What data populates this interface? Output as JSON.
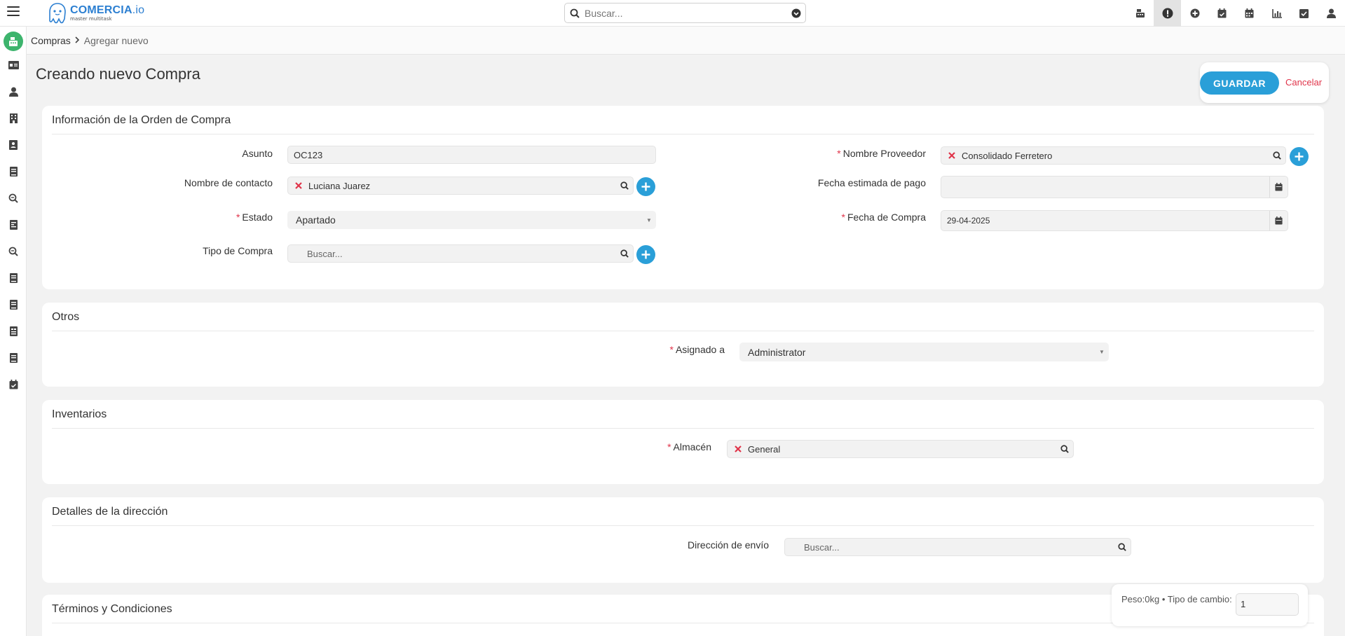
{
  "app": {
    "logo_name": "COMERCIA",
    "logo_suffix": ".io",
    "logo_tagline": "master multitask"
  },
  "search": {
    "placeholder": "Buscar..."
  },
  "top_icons": [
    "cash-register-icon",
    "alert-icon",
    "plus-circle-icon",
    "calendar-check-icon",
    "calendar-icon",
    "chart-icon",
    "checkbox-icon",
    "user-icon"
  ],
  "sidebar_icons": [
    "id-card-icon",
    "user-icon",
    "building-icon",
    "contact-card-icon",
    "book-icon",
    "search-icon",
    "invoice-icon",
    "search-icon",
    "book-icon",
    "book-icon",
    "receipt-icon",
    "book-icon",
    "calendar-check-icon"
  ],
  "breadcrumb": {
    "parent": "Compras",
    "current": "Agregar nuevo"
  },
  "page": {
    "title": "Creando nuevo Compra",
    "save_label": "GUARDAR",
    "cancel_label": "Cancelar"
  },
  "purchase_order": {
    "section_title": "Información de la Orden de Compra",
    "asunto_label": "Asunto",
    "asunto_value": "OC123",
    "contacto_label": "Nombre de contacto",
    "contacto_value": "Luciana Juarez",
    "estado_label": "Estado",
    "estado_value": "Apartado",
    "tipo_label": "Tipo de Compra",
    "tipo_placeholder": "Buscar...",
    "proveedor_label": "Nombre Proveedor",
    "proveedor_value": "Consolidado Ferretero",
    "fecha_pago_label": "Fecha estimada de pago",
    "fecha_pago_value": "",
    "fecha_compra_label": "Fecha de Compra",
    "fecha_compra_value": "29-04-2025"
  },
  "otros": {
    "section_title": "Otros",
    "asignado_label": "Asignado a",
    "asignado_value": "Administrator"
  },
  "inventarios": {
    "section_title": "Inventarios",
    "almacen_label": "Almacén",
    "almacen_value": "General"
  },
  "direccion": {
    "section_title": "Detalles de la dirección",
    "envio_label": "Dirección de envío",
    "envio_placeholder": "Buscar..."
  },
  "terminos": {
    "section_title": "Términos y Condiciones"
  },
  "footer": {
    "summary": "Peso:0kg • Tipo de cambio:",
    "tipo_cambio_value": "1"
  },
  "colors": {
    "primary": "#2a9fd8",
    "danger": "#e0344a",
    "home": "#3db46d"
  }
}
